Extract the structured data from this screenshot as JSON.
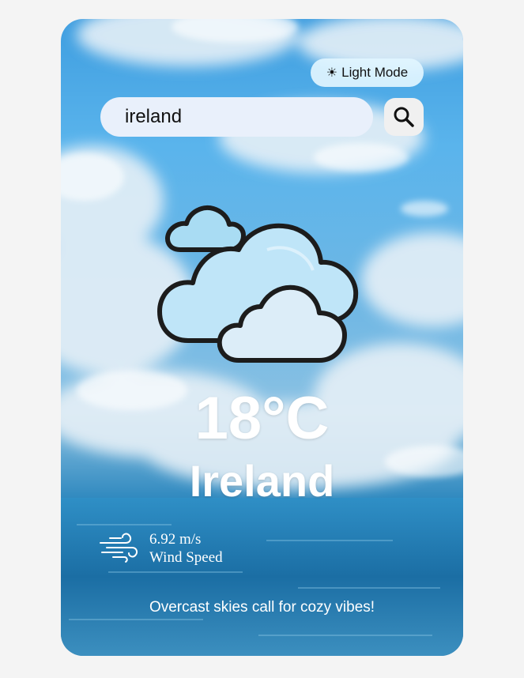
{
  "header": {
    "mode_toggle_label": "Light Mode",
    "mode_toggle_icon": "sun-icon"
  },
  "search": {
    "value": "ireland",
    "button_icon": "search-icon"
  },
  "weather": {
    "condition_icon": "cloudy-icon",
    "temperature": "18°C",
    "city": "Ireland",
    "wind_speed": "6.92 m/s",
    "wind_label": "Wind Speed",
    "wind_icon": "wind-icon",
    "tagline": "Overcast skies call for cozy vibes!"
  },
  "colors": {
    "page_background": "#f4f4f4",
    "search_field": "#e9f0fb",
    "toggle_background": "#e1f5ff",
    "text_on_card": "#ffffff"
  }
}
